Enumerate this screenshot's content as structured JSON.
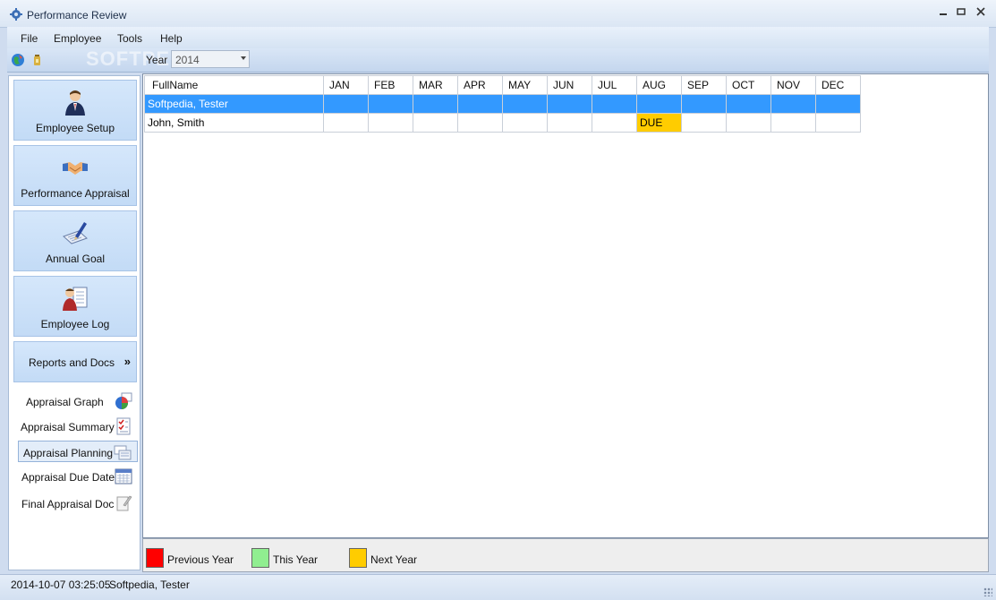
{
  "window": {
    "title": "Performance Review"
  },
  "menu": [
    "File",
    "Employee",
    "Tools",
    "Help"
  ],
  "toolbar": {
    "year_label": "Year",
    "year_value": "2014",
    "watermark": "SOFTPEDIA"
  },
  "nav": {
    "buttons": [
      {
        "label": "Employee Setup",
        "icon": "employee-icon"
      },
      {
        "label": "Performance Appraisal",
        "icon": "handshake-icon"
      },
      {
        "label": "Annual Goal",
        "icon": "pen-notepad-icon"
      },
      {
        "label": "Employee Log",
        "icon": "employee-log-icon"
      }
    ],
    "reports": {
      "label": "Reports and Docs",
      "chevron": "»"
    },
    "sub_items": [
      {
        "label": "Appraisal Graph",
        "icon": "pie-chart-icon"
      },
      {
        "label": "Appraisal Summary",
        "icon": "checklist-icon"
      },
      {
        "label": "Appraisal Planning",
        "icon": "planning-icon",
        "active": true
      },
      {
        "label": "Appraisal Due Date",
        "icon": "calendar-icon"
      },
      {
        "label": "Final Appraisal Doc",
        "icon": "document-icon"
      }
    ]
  },
  "grid": {
    "columns": [
      "FullName",
      "JAN",
      "FEB",
      "MAR",
      "APR",
      "MAY",
      "JUN",
      "JUL",
      "AUG",
      "SEP",
      "OCT",
      "NOV",
      "DEC"
    ],
    "rows": [
      {
        "name": "Softpedia, Tester",
        "selected": true,
        "cells": [
          "",
          "",
          "",
          "",
          "",
          "",
          "",
          "",
          "",
          "",
          "",
          ""
        ]
      },
      {
        "name": "John, Smith",
        "selected": false,
        "cells": [
          "",
          "",
          "",
          "",
          "",
          "",
          "",
          "DUE",
          "",
          "",
          "",
          ""
        ]
      }
    ]
  },
  "legend": [
    {
      "label": "Previous Year",
      "color": "#ff0000"
    },
    {
      "label": "This Year",
      "color": "#90ee90"
    },
    {
      "label": "Next Year",
      "color": "#ffcc00"
    }
  ],
  "status": {
    "timestamp": "2014-10-07 03:25:05",
    "user": "Softpedia, Tester"
  }
}
